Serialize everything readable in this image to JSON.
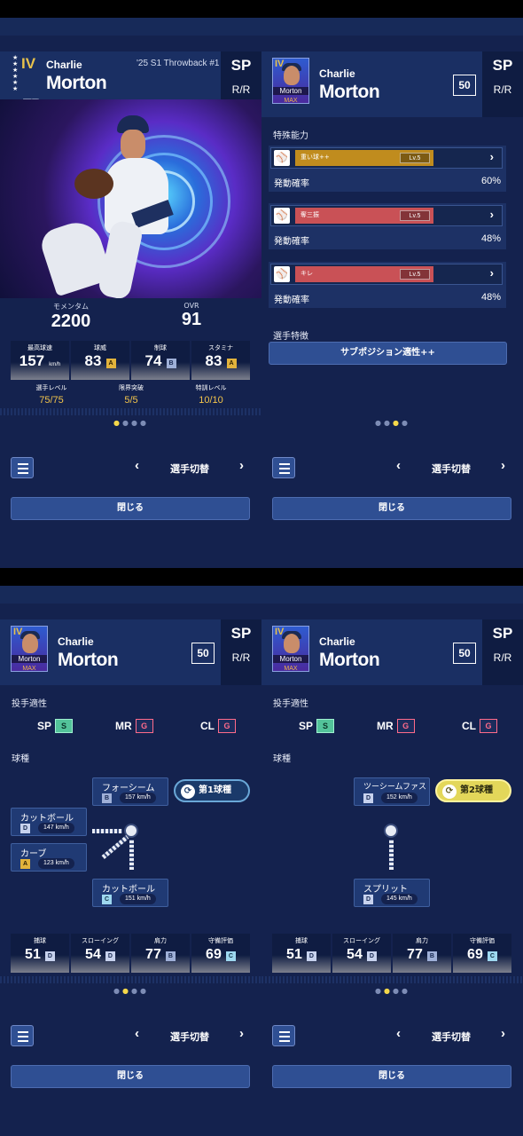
{
  "player": {
    "version": "IV",
    "first_name": "Charlie",
    "last_name": "Morton",
    "card_name": "Morton",
    "max_label": "MAX",
    "series": "'25 S1 Throwback #1",
    "team_logo": "TB",
    "position": "SP",
    "hand": "R/R",
    "level_box": "50"
  },
  "panel1": {
    "momentum_label": "モメンタム",
    "momentum": "2200",
    "ovr_label": "OVR",
    "ovr": "91",
    "stats": [
      {
        "label": "最高球速",
        "value": "157",
        "unit": "km/h",
        "grade": ""
      },
      {
        "label": "球威",
        "value": "83",
        "unit": "",
        "grade": "A"
      },
      {
        "label": "制球",
        "value": "74",
        "unit": "",
        "grade": "B"
      },
      {
        "label": "スタミナ",
        "value": "83",
        "unit": "",
        "grade": "A"
      }
    ],
    "levels": [
      {
        "label": "選手レベル",
        "value": "75/75"
      },
      {
        "label": "限界突破",
        "value": "5/5"
      },
      {
        "label": "特訓レベル",
        "value": "10/10"
      }
    ]
  },
  "panel2": {
    "section_title": "特殊能力",
    "abilities": [
      {
        "name": "重い球++",
        "level": "Lv.5",
        "prob_label": "発動確率",
        "prob": "60%",
        "color": "#c08c1e"
      },
      {
        "name": "奪三振",
        "level": "Lv.5",
        "prob_label": "発動確率",
        "prob": "48%",
        "color": "#c95156"
      },
      {
        "name": "キレ",
        "level": "Lv.5",
        "prob_label": "発動確率",
        "prob": "48%",
        "color": "#c95156"
      }
    ],
    "trait_title": "選手特徴",
    "trait_button": "サブポジション適性++"
  },
  "pitching": {
    "aptitude_title": "投手適性",
    "aptitudes": [
      {
        "pos": "SP",
        "grade": "S"
      },
      {
        "pos": "MR",
        "grade": "G"
      },
      {
        "pos": "CL",
        "grade": "G"
      }
    ],
    "pitch_title": "球種",
    "panel3": {
      "badge": "第1球種",
      "pitches": [
        {
          "name": "フォーシーム",
          "grade": "B",
          "speed": "157 km/h"
        },
        {
          "name": "カットボール",
          "grade": "D",
          "speed": "147 km/h"
        },
        {
          "name": "カーブ",
          "grade": "A",
          "speed": "123 km/h"
        },
        {
          "name": "カットボール",
          "grade": "C",
          "speed": "151 km/h"
        }
      ]
    },
    "panel4": {
      "badge": "第2球種",
      "pitches": [
        {
          "name": "ツーシームファスト",
          "grade": "D",
          "speed": "152 km/h"
        },
        {
          "name": "スプリット",
          "grade": "D",
          "speed": "145 km/h"
        }
      ]
    },
    "defense": [
      {
        "label": "捕球",
        "value": "51",
        "grade": "D"
      },
      {
        "label": "スローイング",
        "value": "54",
        "grade": "D"
      },
      {
        "label": "肩力",
        "value": "77",
        "grade": "B"
      },
      {
        "label": "守備評価",
        "value": "69",
        "grade": "C"
      }
    ]
  },
  "nav": {
    "switch_label": "選手切替",
    "prev": "‹",
    "next": "›",
    "close_label": "閉じる",
    "dot": "●"
  },
  "colors": {
    "bg": "#14224e",
    "header": "#1a2f63",
    "button": "#2f4f93",
    "accent_yellow": "#f5d84a"
  }
}
